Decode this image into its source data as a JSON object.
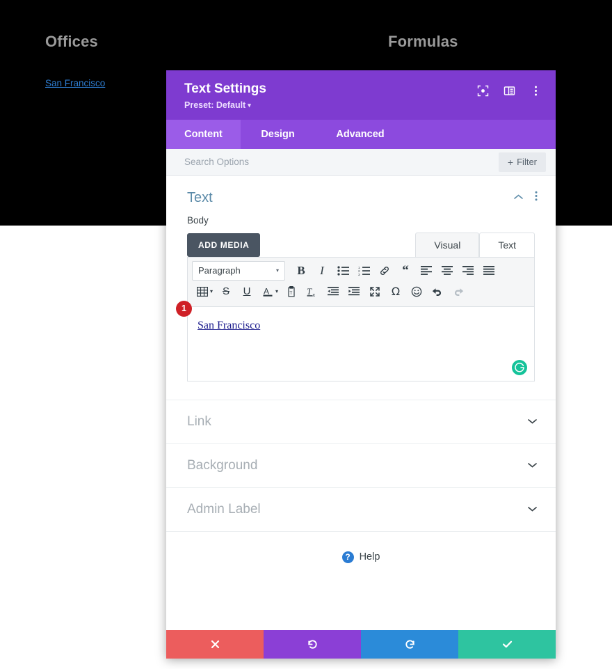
{
  "background": {
    "headings": [
      {
        "label": "Offices"
      },
      {
        "label": "Formulas"
      }
    ],
    "link_label": "San Francisco"
  },
  "modal": {
    "title": "Text Settings",
    "preset_label": "Preset: Default",
    "preset_caret": "▾",
    "header_icons": [
      {
        "name": "focus-icon"
      },
      {
        "name": "layout-columns-icon"
      },
      {
        "name": "more-vertical-icon"
      }
    ],
    "tabs": [
      {
        "label": "Content",
        "active": true
      },
      {
        "label": "Design",
        "active": false
      },
      {
        "label": "Advanced",
        "active": false
      }
    ],
    "search": {
      "placeholder": "Search Options",
      "filter_label": "Filter",
      "filter_plus": "+"
    },
    "text_section": {
      "title": "Text",
      "body_label": "Body",
      "add_media_label": "ADD MEDIA",
      "editor_tabs": [
        {
          "label": "Visual",
          "active": true
        },
        {
          "label": "Text",
          "active": false
        }
      ],
      "format_select_value": "Paragraph",
      "select_caret": "▾",
      "toolbar_row1": [
        {
          "name": "bold-icon",
          "glyph": "B"
        },
        {
          "name": "italic-icon",
          "glyph": "I"
        },
        {
          "name": "bullet-list-icon",
          "glyph": ""
        },
        {
          "name": "numbered-list-icon",
          "glyph": ""
        },
        {
          "name": "link-icon",
          "glyph": ""
        },
        {
          "name": "blockquote-icon",
          "glyph": ""
        },
        {
          "name": "align-left-icon",
          "glyph": ""
        },
        {
          "name": "align-center-icon",
          "glyph": ""
        },
        {
          "name": "align-right-icon",
          "glyph": ""
        },
        {
          "name": "align-justify-icon",
          "glyph": ""
        }
      ],
      "toolbar_row2": [
        {
          "name": "table-icon"
        },
        {
          "name": "strikethrough-icon"
        },
        {
          "name": "underline-icon"
        },
        {
          "name": "text-color-icon"
        },
        {
          "name": "paste-as-text-icon"
        },
        {
          "name": "clear-formatting-icon"
        },
        {
          "name": "outdent-icon"
        },
        {
          "name": "indent-icon"
        },
        {
          "name": "fullscreen-icon"
        },
        {
          "name": "special-character-icon"
        },
        {
          "name": "emoji-icon"
        },
        {
          "name": "undo-icon"
        },
        {
          "name": "redo-icon"
        }
      ],
      "content_text": "San Francisco",
      "badge_number": "1",
      "grammarly_glyph": "G"
    },
    "accordion": [
      {
        "label": "Link",
        "chevron": "⌄"
      },
      {
        "label": "Background",
        "chevron": "⌄"
      },
      {
        "label": "Admin Label",
        "chevron": "⌄"
      }
    ],
    "help": {
      "icon_glyph": "?",
      "label": "Help"
    },
    "footer": [
      {
        "name": "cancel-button",
        "glyph": "✖",
        "color": "#ec5d5d"
      },
      {
        "name": "undo-button",
        "glyph": "↺",
        "color": "#8b3fd6"
      },
      {
        "name": "redo-button",
        "glyph": "↻",
        "color": "#2b8bd9"
      },
      {
        "name": "save-button",
        "glyph": "✔",
        "color": "#2ec4a0"
      }
    ]
  }
}
